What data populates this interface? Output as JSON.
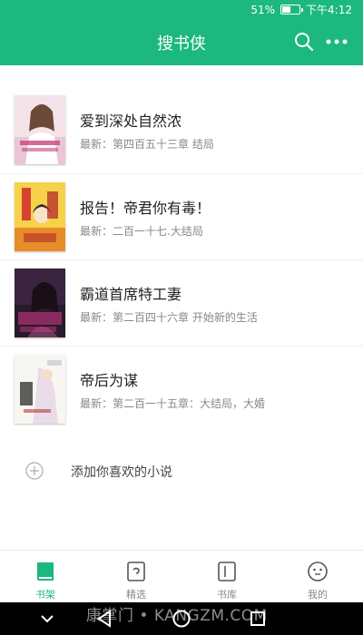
{
  "status_bar": {
    "battery": "51%",
    "time": "下午4:12",
    "battery_level": 0.51
  },
  "app_bar": {
    "title": "搜书侠",
    "search_icon": "search-icon",
    "more_icon": "more-icon"
  },
  "books": [
    {
      "title": "爱到深处自然浓",
      "latest": "最新：第四百五十三章 结局"
    },
    {
      "title": "报告！帝君你有毒！",
      "latest": "最新：二百一十七.大结局"
    },
    {
      "title": "霸道首席特工妻",
      "latest": "最新：第二百四十六章 开始新的生活"
    },
    {
      "title": "帝后为谋",
      "latest": "最新：第二百一十五章：大结局，大婚"
    }
  ],
  "add_book": {
    "label": "添加你喜欢的小说",
    "icon": "plus-circle-icon"
  },
  "bottom_nav": {
    "items": [
      {
        "label": "书架",
        "icon": "bookshelf-icon",
        "active": true
      },
      {
        "label": "精选",
        "icon": "featured-icon",
        "active": false
      },
      {
        "label": "书库",
        "icon": "library-icon",
        "active": false
      },
      {
        "label": "我的",
        "icon": "profile-icon",
        "active": false
      }
    ]
  },
  "watermark": "康掌门 • KANGZM.COM",
  "colors": {
    "primary": "#1cb880",
    "text": "#222222",
    "secondary_text": "#888888"
  }
}
